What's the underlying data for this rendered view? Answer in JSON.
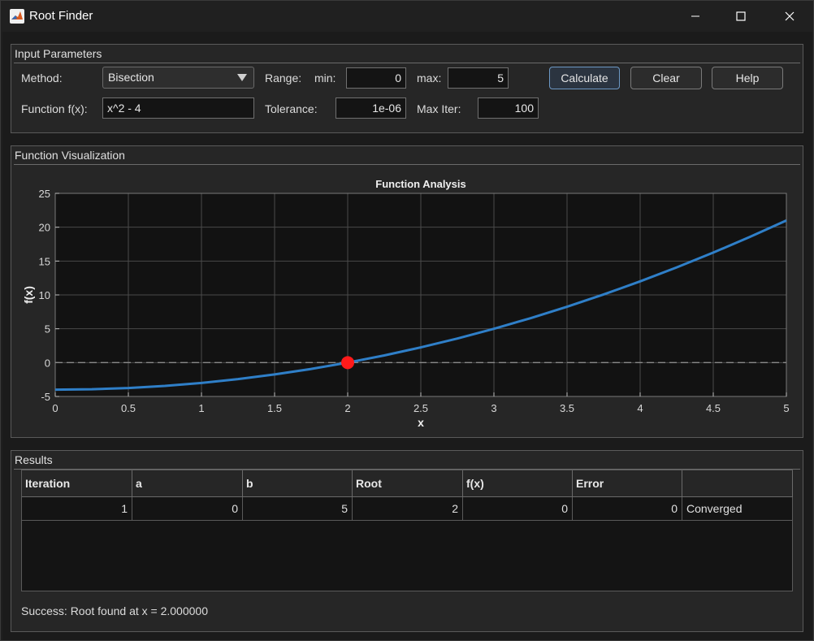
{
  "window": {
    "title": "Root Finder"
  },
  "input_panel": {
    "title": "Input Parameters",
    "method_label": "Method:",
    "method_value": "Bisection",
    "range_label": "Range:",
    "min_label": "min:",
    "min_value": "0",
    "max_label": "max:",
    "max_value": "5",
    "calculate_label": "Calculate",
    "clear_label": "Clear",
    "help_label": "Help",
    "function_label": "Function f(x):",
    "function_value": "x^2 - 4",
    "tolerance_label": "Tolerance:",
    "tolerance_value": "1e-06",
    "maxiter_label": "Max Iter:",
    "maxiter_value": "100"
  },
  "viz_panel": {
    "title": "Function Visualization"
  },
  "chart_data": {
    "type": "line",
    "title": "Function Analysis",
    "xlabel": "x",
    "ylabel": "f(x)",
    "xlim": [
      0,
      5
    ],
    "ylim": [
      -5,
      25
    ],
    "xticks": [
      "0",
      "0.5",
      "1",
      "1.5",
      "2",
      "2.5",
      "3",
      "3.5",
      "4",
      "4.5",
      "5"
    ],
    "yticks": [
      "-5",
      "0",
      "5",
      "10",
      "15",
      "20",
      "25"
    ],
    "grid": true,
    "series": [
      {
        "x": [
          0,
          0.25,
          0.5,
          0.75,
          1,
          1.25,
          1.5,
          1.75,
          2,
          2.25,
          2.5,
          2.75,
          3,
          3.25,
          3.5,
          3.75,
          4,
          4.25,
          4.5,
          4.75,
          5
        ],
        "values": [
          -4,
          -3.9375,
          -3.75,
          -3.4375,
          -3,
          -2.4375,
          -1.75,
          -0.9375,
          0,
          1.0625,
          2.25,
          3.5625,
          5,
          6.5625,
          8.25,
          10.0625,
          12,
          14.0625,
          16.25,
          18.5625,
          21
        ],
        "color": "#2f7fc8"
      }
    ],
    "zero_line": 0,
    "root_marker": {
      "x": 2,
      "y": 0,
      "color": "#ff1a1a"
    }
  },
  "results_panel": {
    "title": "Results",
    "columns": [
      "Iteration",
      "a",
      "b",
      "Root",
      "f(x)",
      "Error",
      ""
    ],
    "rows": [
      [
        "1",
        "0",
        "5",
        "2",
        "0",
        "0",
        "Converged"
      ]
    ],
    "status": "Success: Root found at x = 2.000000"
  }
}
